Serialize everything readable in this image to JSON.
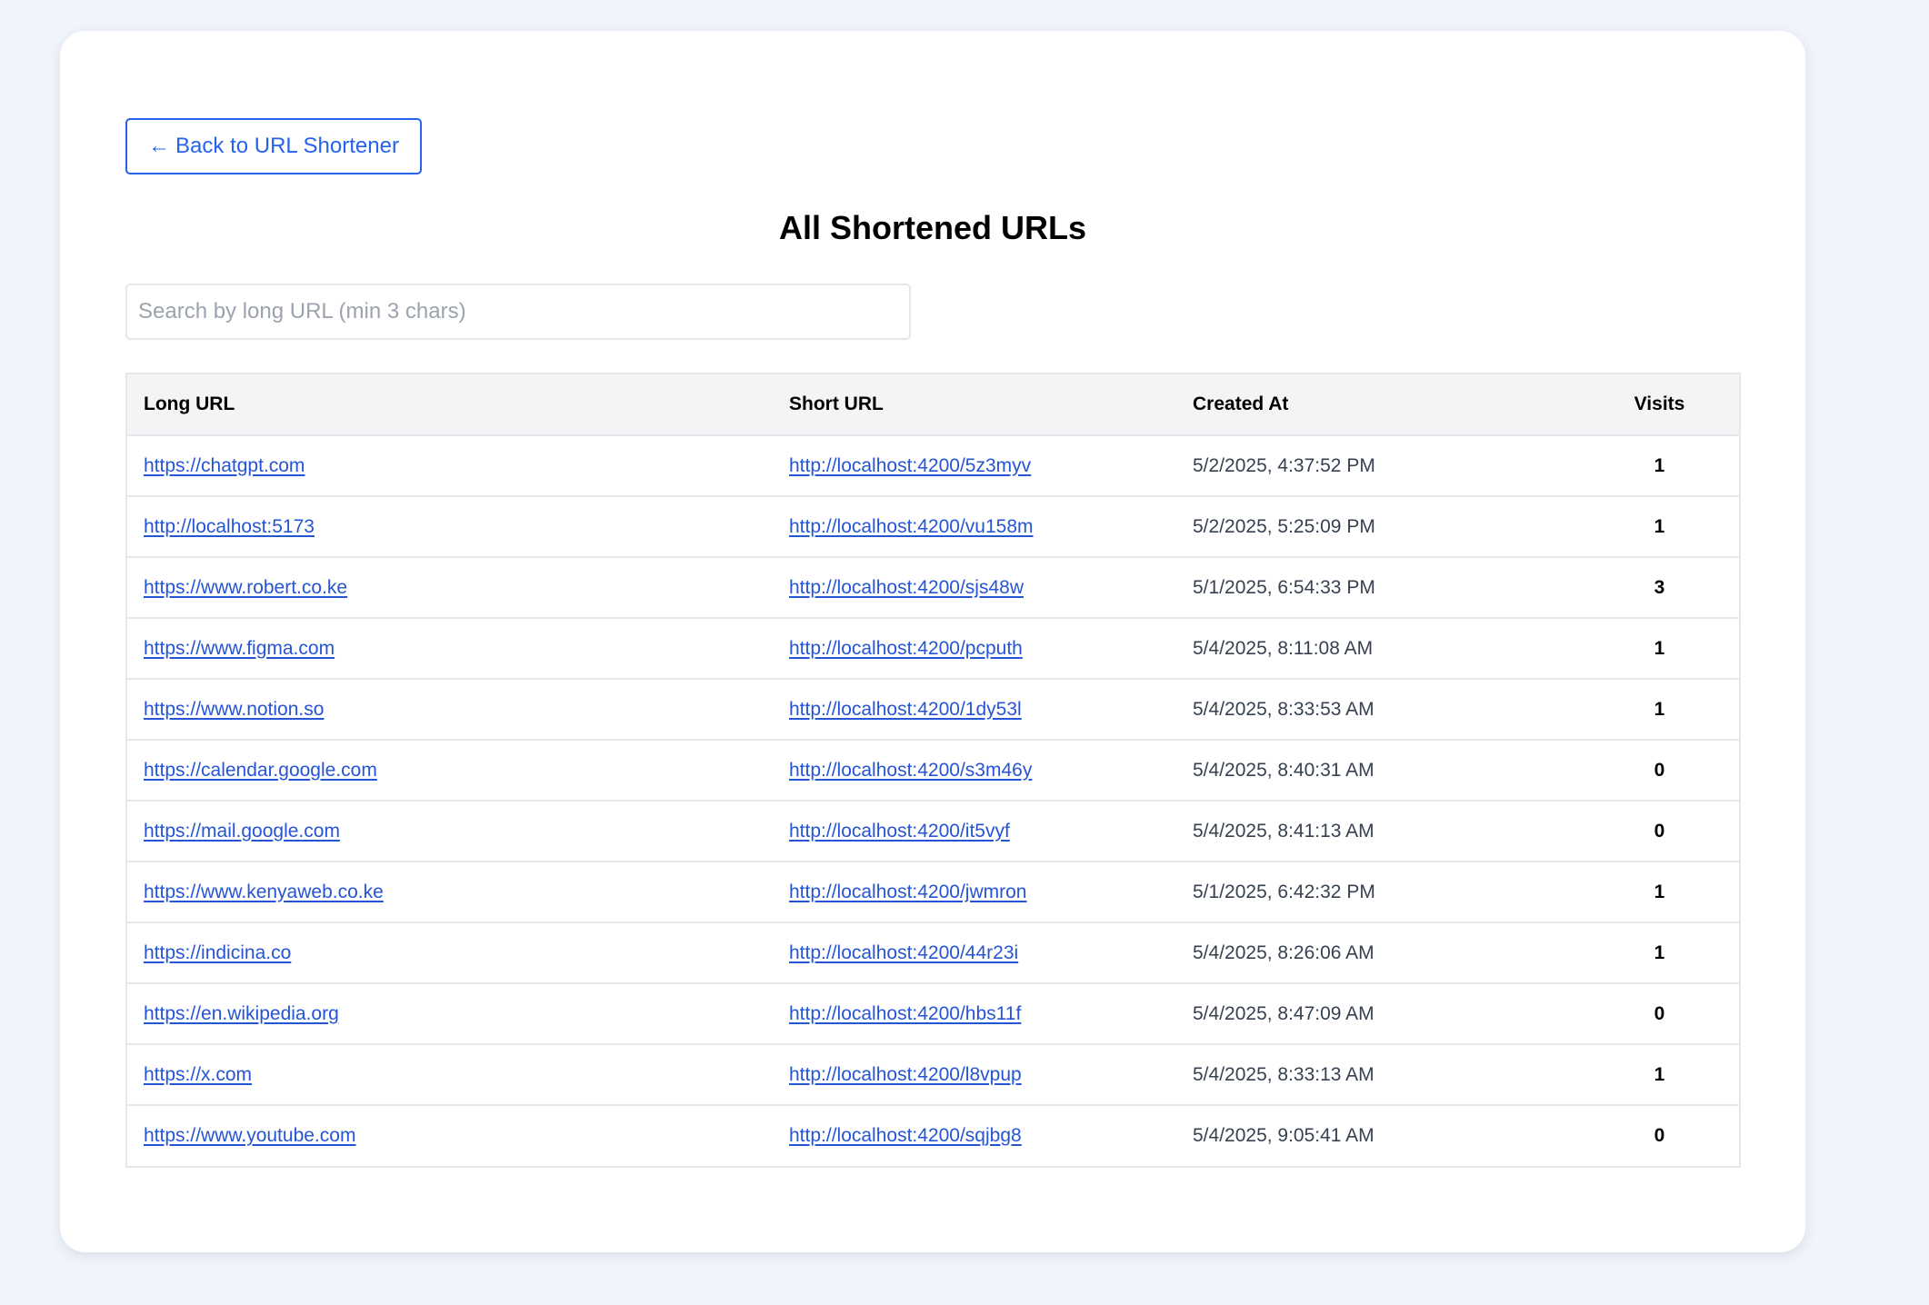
{
  "back_button": {
    "arrow": "←",
    "label": "Back to URL Shortener"
  },
  "page_title": "All Shortened URLs",
  "search": {
    "placeholder": "Search by long URL (min 3 chars)",
    "value": ""
  },
  "table": {
    "headers": {
      "long_url": "Long URL",
      "short_url": "Short URL",
      "created_at": "Created At",
      "visits": "Visits"
    },
    "rows": [
      {
        "long_url": "https://chatgpt.com",
        "short_url": "http://localhost:4200/5z3myv",
        "created_at": "5/2/2025, 4:37:52 PM",
        "visits": "1"
      },
      {
        "long_url": "http://localhost:5173",
        "short_url": "http://localhost:4200/vu158m",
        "created_at": "5/2/2025, 5:25:09 PM",
        "visits": "1"
      },
      {
        "long_url": "https://www.robert.co.ke",
        "short_url": "http://localhost:4200/sjs48w",
        "created_at": "5/1/2025, 6:54:33 PM",
        "visits": "3"
      },
      {
        "long_url": "https://www.figma.com",
        "short_url": "http://localhost:4200/pcputh",
        "created_at": "5/4/2025, 8:11:08 AM",
        "visits": "1"
      },
      {
        "long_url": "https://www.notion.so",
        "short_url": "http://localhost:4200/1dy53l",
        "created_at": "5/4/2025, 8:33:53 AM",
        "visits": "1"
      },
      {
        "long_url": "https://calendar.google.com",
        "short_url": "http://localhost:4200/s3m46y",
        "created_at": "5/4/2025, 8:40:31 AM",
        "visits": "0"
      },
      {
        "long_url": "https://mail.google.com",
        "short_url": "http://localhost:4200/it5vyf",
        "created_at": "5/4/2025, 8:41:13 AM",
        "visits": "0"
      },
      {
        "long_url": "https://www.kenyaweb.co.ke",
        "short_url": "http://localhost:4200/jwmron",
        "created_at": "5/1/2025, 6:42:32 PM",
        "visits": "1"
      },
      {
        "long_url": "https://indicina.co",
        "short_url": "http://localhost:4200/44r23i",
        "created_at": "5/4/2025, 8:26:06 AM",
        "visits": "1"
      },
      {
        "long_url": "https://en.wikipedia.org",
        "short_url": "http://localhost:4200/hbs11f",
        "created_at": "5/4/2025, 8:47:09 AM",
        "visits": "0"
      },
      {
        "long_url": "https://x.com",
        "short_url": "http://localhost:4200/l8vpup",
        "created_at": "5/4/2025, 8:33:13 AM",
        "visits": "1"
      },
      {
        "long_url": "https://www.youtube.com",
        "short_url": "http://localhost:4200/sqjbg8",
        "created_at": "5/4/2025, 9:05:41 AM",
        "visits": "0"
      }
    ]
  },
  "colors": {
    "accent": "#2563eb",
    "link": "#2554d6",
    "background": "#f0f4fb",
    "header_bg": "#f3f4f6",
    "border": "#e5e7eb"
  }
}
